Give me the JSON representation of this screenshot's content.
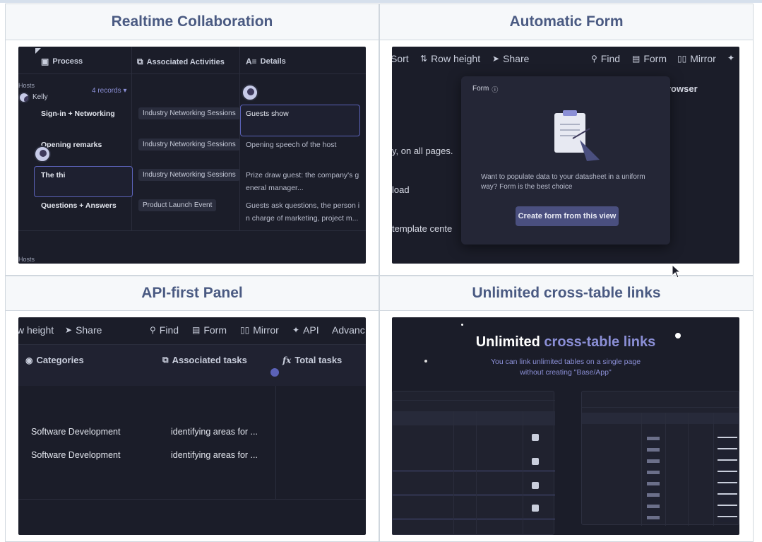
{
  "cards": [
    {
      "title": "Realtime Collaboration"
    },
    {
      "title": "Automatic Form"
    },
    {
      "title": "API-first Panel"
    },
    {
      "title": "Unlimited cross-table links"
    }
  ],
  "collab": {
    "columns": [
      "Process",
      "Associated Activities",
      "Details"
    ],
    "group_label": "Hosts",
    "group_user": "Kelly",
    "records_count": "4 records ▾",
    "footer_group": "Hosts",
    "rows": [
      {
        "process": "Sign-in + Networking",
        "activity": "Industry Networking Sessions",
        "details": "Guests show"
      },
      {
        "process": "Opening remarks",
        "activity": "Industry Networking Sessions",
        "details": "Opening speech of the host"
      },
      {
        "process": "The thi",
        "activity": "Industry Networking Sessions",
        "details": "Prize draw guest: the company's g",
        "details2": "eneral manager..."
      },
      {
        "process": "Questions + Answers",
        "activity": "Product Launch Event",
        "details": "Guests ask questions, the person i",
        "details2": "n charge of marketing, project m..."
      }
    ]
  },
  "form": {
    "toolbar": [
      "Sort",
      "Row height",
      "Share",
      "Find",
      "Form",
      "Mirror"
    ],
    "side_right": "rowser",
    "side_left": [
      "y, on all pages.",
      "load",
      "template cente"
    ],
    "popup_title": "Form",
    "popup_text": "Want to populate data to your datasheet in a uniform way? Form is the best choice",
    "popup_button": "Create form from this view"
  },
  "api": {
    "toolbar": [
      "w height",
      "Share",
      "Find",
      "Form",
      "Mirror",
      "API",
      "Advanc"
    ],
    "columns": [
      "Categories",
      "Associated tasks",
      "Total tasks"
    ],
    "rows": [
      {
        "category": "Software Development",
        "task": "identifying areas for ..."
      },
      {
        "category": "Software Development",
        "task": "identifying areas for ..."
      }
    ]
  },
  "links": {
    "title_plain": "Unlimited",
    "title_accent": "cross-table links",
    "subtitle_line1": "You can link unlimited tables on a single page",
    "subtitle_line2": "without creating \"Base/App\""
  },
  "colors": {
    "accent": "#8b8fd6",
    "panel_bg": "#1b1d29",
    "title_text": "#4a5a82"
  }
}
